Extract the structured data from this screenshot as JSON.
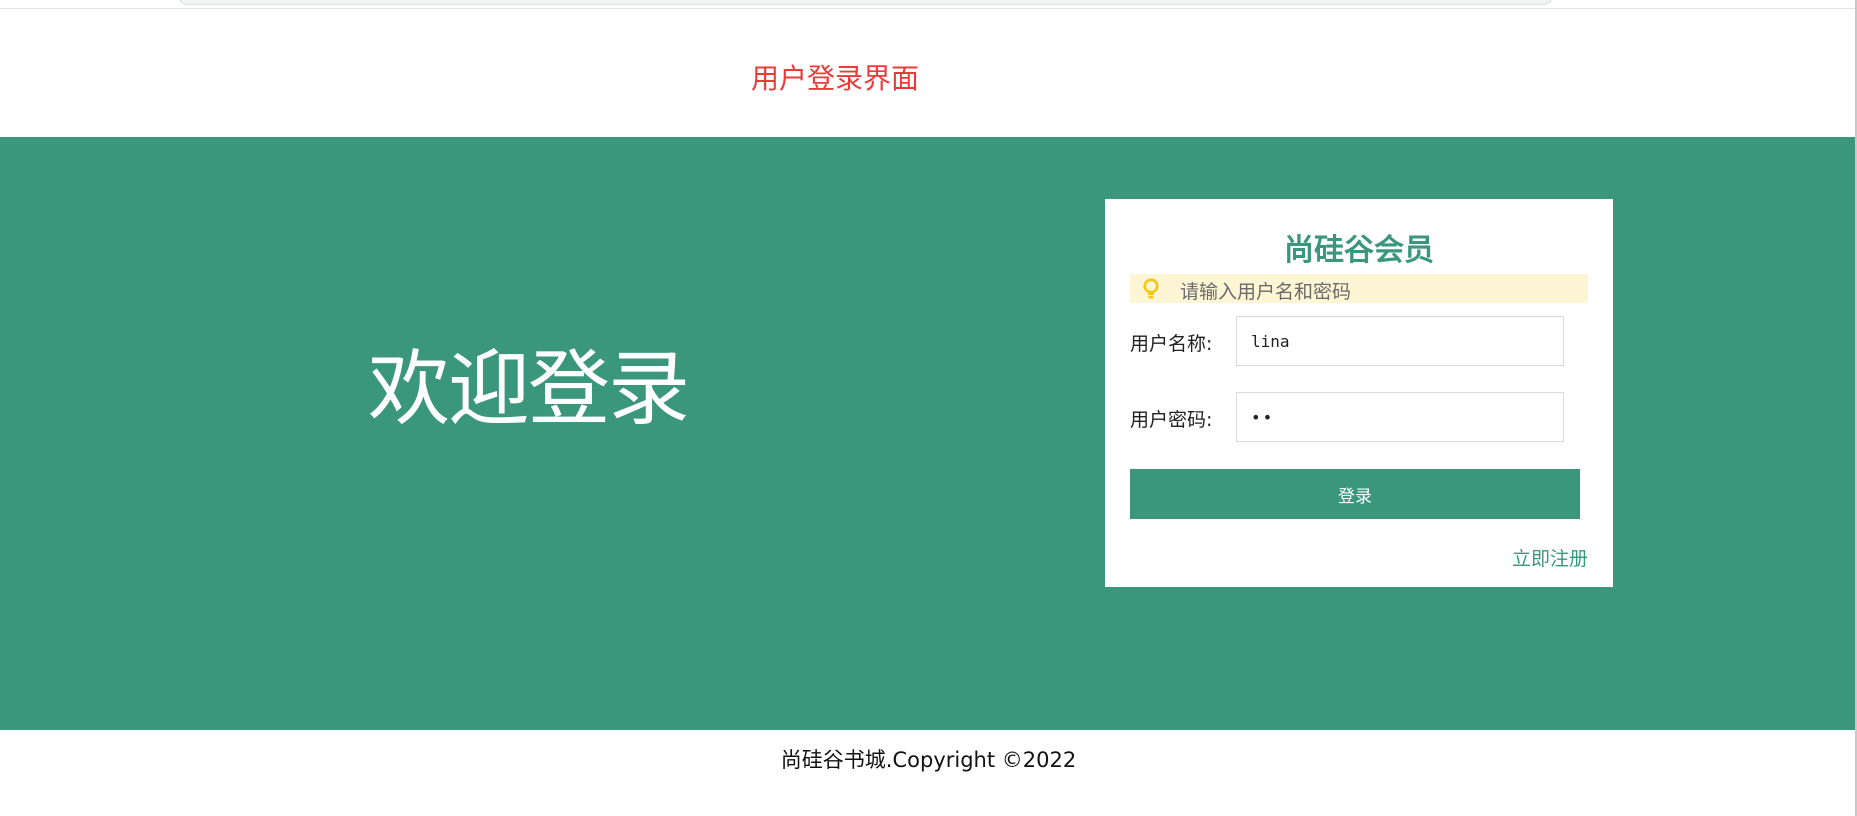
{
  "header": {
    "title": "用户登录界面"
  },
  "banner": {
    "welcome_text": "欢迎登录"
  },
  "login": {
    "title": "尚硅谷会员",
    "tip": "请输入用户名和密码",
    "tip_icon": "lightbulb-icon",
    "username_label": "用户名称:",
    "username_value": "lina",
    "password_label": "用户密码:",
    "password_value": "ab",
    "submit_label": "登录",
    "register_label": "立即注册"
  },
  "footer": {
    "copyright": "尚硅谷书城.Copyright ©2022"
  },
  "colors": {
    "primary_green": "#3a977c",
    "header_red": "#ea3b3b",
    "tip_background": "#fdf5d3",
    "tip_icon": "#f5c518"
  }
}
